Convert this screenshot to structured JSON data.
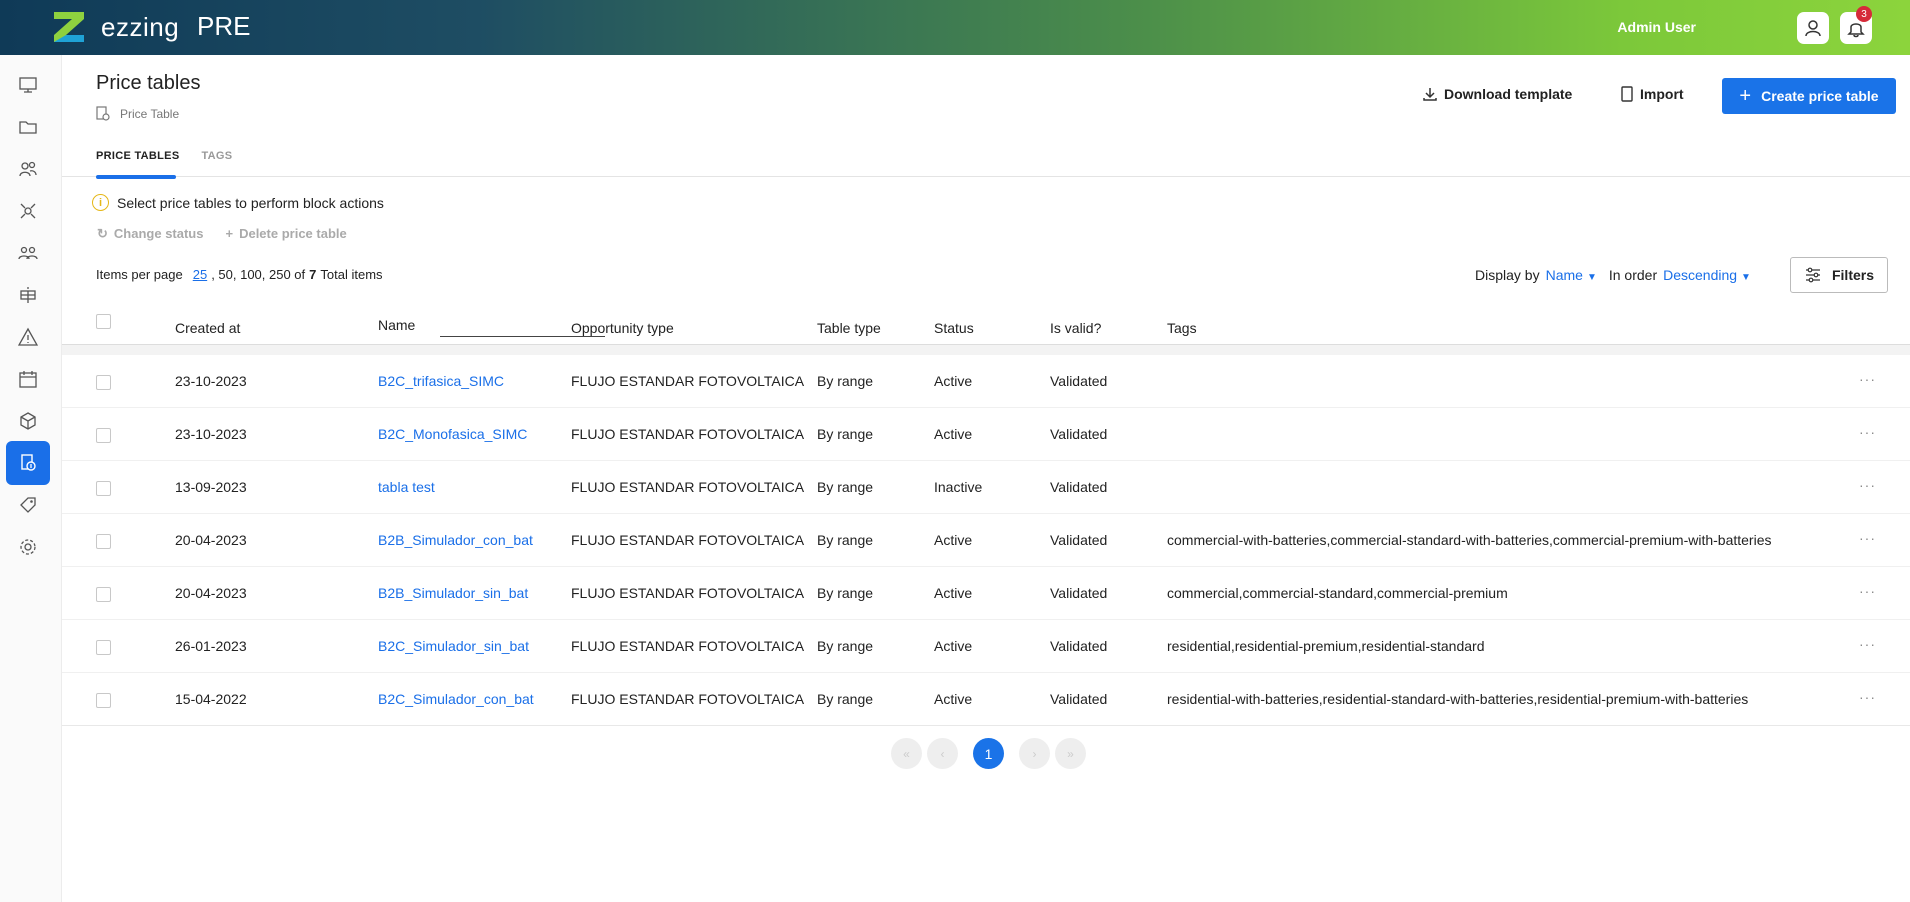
{
  "header": {
    "brand": "ezzing",
    "env": "PRE",
    "user_name": "Admin User",
    "notification_count": "3"
  },
  "sidebar": {
    "icons": [
      "dashboard-icon",
      "folder-icon",
      "users-icon",
      "network-icon",
      "team-icon",
      "solar-panel-icon",
      "alert-icon",
      "calendar-icon",
      "box-icon",
      "price-table-icon",
      "tag-icon",
      "settings-icon"
    ],
    "active": "price-table-icon"
  },
  "page": {
    "title": "Price tables",
    "breadcrumb": "Price Table",
    "download_label": "Download template",
    "import_label": "Import",
    "create_label": "Create price table"
  },
  "tabs": [
    {
      "label": "PRICE TABLES",
      "active": true
    },
    {
      "label": "TAGS",
      "active": false
    }
  ],
  "block_actions": {
    "info": "Select price tables to perform block actions",
    "change_status": "Change status",
    "delete": "Delete price table"
  },
  "pagination_opts": {
    "items_per_page_label": "Items per page",
    "selected": "25",
    "others": ", 50, 100, 250 of",
    "total": "7",
    "total_label": "Total items"
  },
  "sort": {
    "display_by_label": "Display by",
    "display_by_value": "Name",
    "order_label": "In order",
    "order_value": "Descending",
    "filters_label": "Filters"
  },
  "table": {
    "columns": [
      "Created at",
      "Name",
      "Opportunity type",
      "Table type",
      "Status",
      "Is valid?",
      "Tags"
    ],
    "rows": [
      {
        "created": "23-10-2023",
        "name": "B2C_trifasica_SIMC",
        "opp": "FLUJO ESTANDAR FOTOVOLTAICA",
        "type": "By range",
        "status": "Active",
        "valid": "Validated",
        "tags": ""
      },
      {
        "created": "23-10-2023",
        "name": "B2C_Monofasica_SIMC",
        "opp": "FLUJO ESTANDAR FOTOVOLTAICA",
        "type": "By range",
        "status": "Active",
        "valid": "Validated",
        "tags": ""
      },
      {
        "created": "13-09-2023",
        "name": "tabla test",
        "opp": "FLUJO ESTANDAR FOTOVOLTAICA",
        "type": "By range",
        "status": "Inactive",
        "valid": "Validated",
        "tags": ""
      },
      {
        "created": "20-04-2023",
        "name": "B2B_Simulador_con_bat",
        "opp": "FLUJO ESTANDAR FOTOVOLTAICA",
        "type": "By range",
        "status": "Active",
        "valid": "Validated",
        "tags": "commercial-with-batteries,commercial-standard-with-batteries,commercial-premium-with-batteries"
      },
      {
        "created": "20-04-2023",
        "name": "B2B_Simulador_sin_bat",
        "opp": "FLUJO ESTANDAR FOTOVOLTAICA",
        "type": "By range",
        "status": "Active",
        "valid": "Validated",
        "tags": "commercial,commercial-standard,commercial-premium"
      },
      {
        "created": "26-01-2023",
        "name": "B2C_Simulador_sin_bat",
        "opp": "FLUJO ESTANDAR FOTOVOLTAICA",
        "type": "By range",
        "status": "Active",
        "valid": "Validated",
        "tags": "residential,residential-premium,residential-standard"
      },
      {
        "created": "15-04-2022",
        "name": "B2C_Simulador_con_bat",
        "opp": "FLUJO ESTANDAR FOTOVOLTAICA",
        "type": "By range",
        "status": "Active",
        "valid": "Validated",
        "tags": "residential-with-batteries,residential-standard-with-batteries,residential-premium-with-batteries"
      }
    ]
  },
  "pager": {
    "current": "1",
    "first": "«",
    "prev": "‹",
    "next": "›",
    "last": "»"
  },
  "colors": {
    "accent": "#1a73e8",
    "warning": "#e5b718"
  }
}
